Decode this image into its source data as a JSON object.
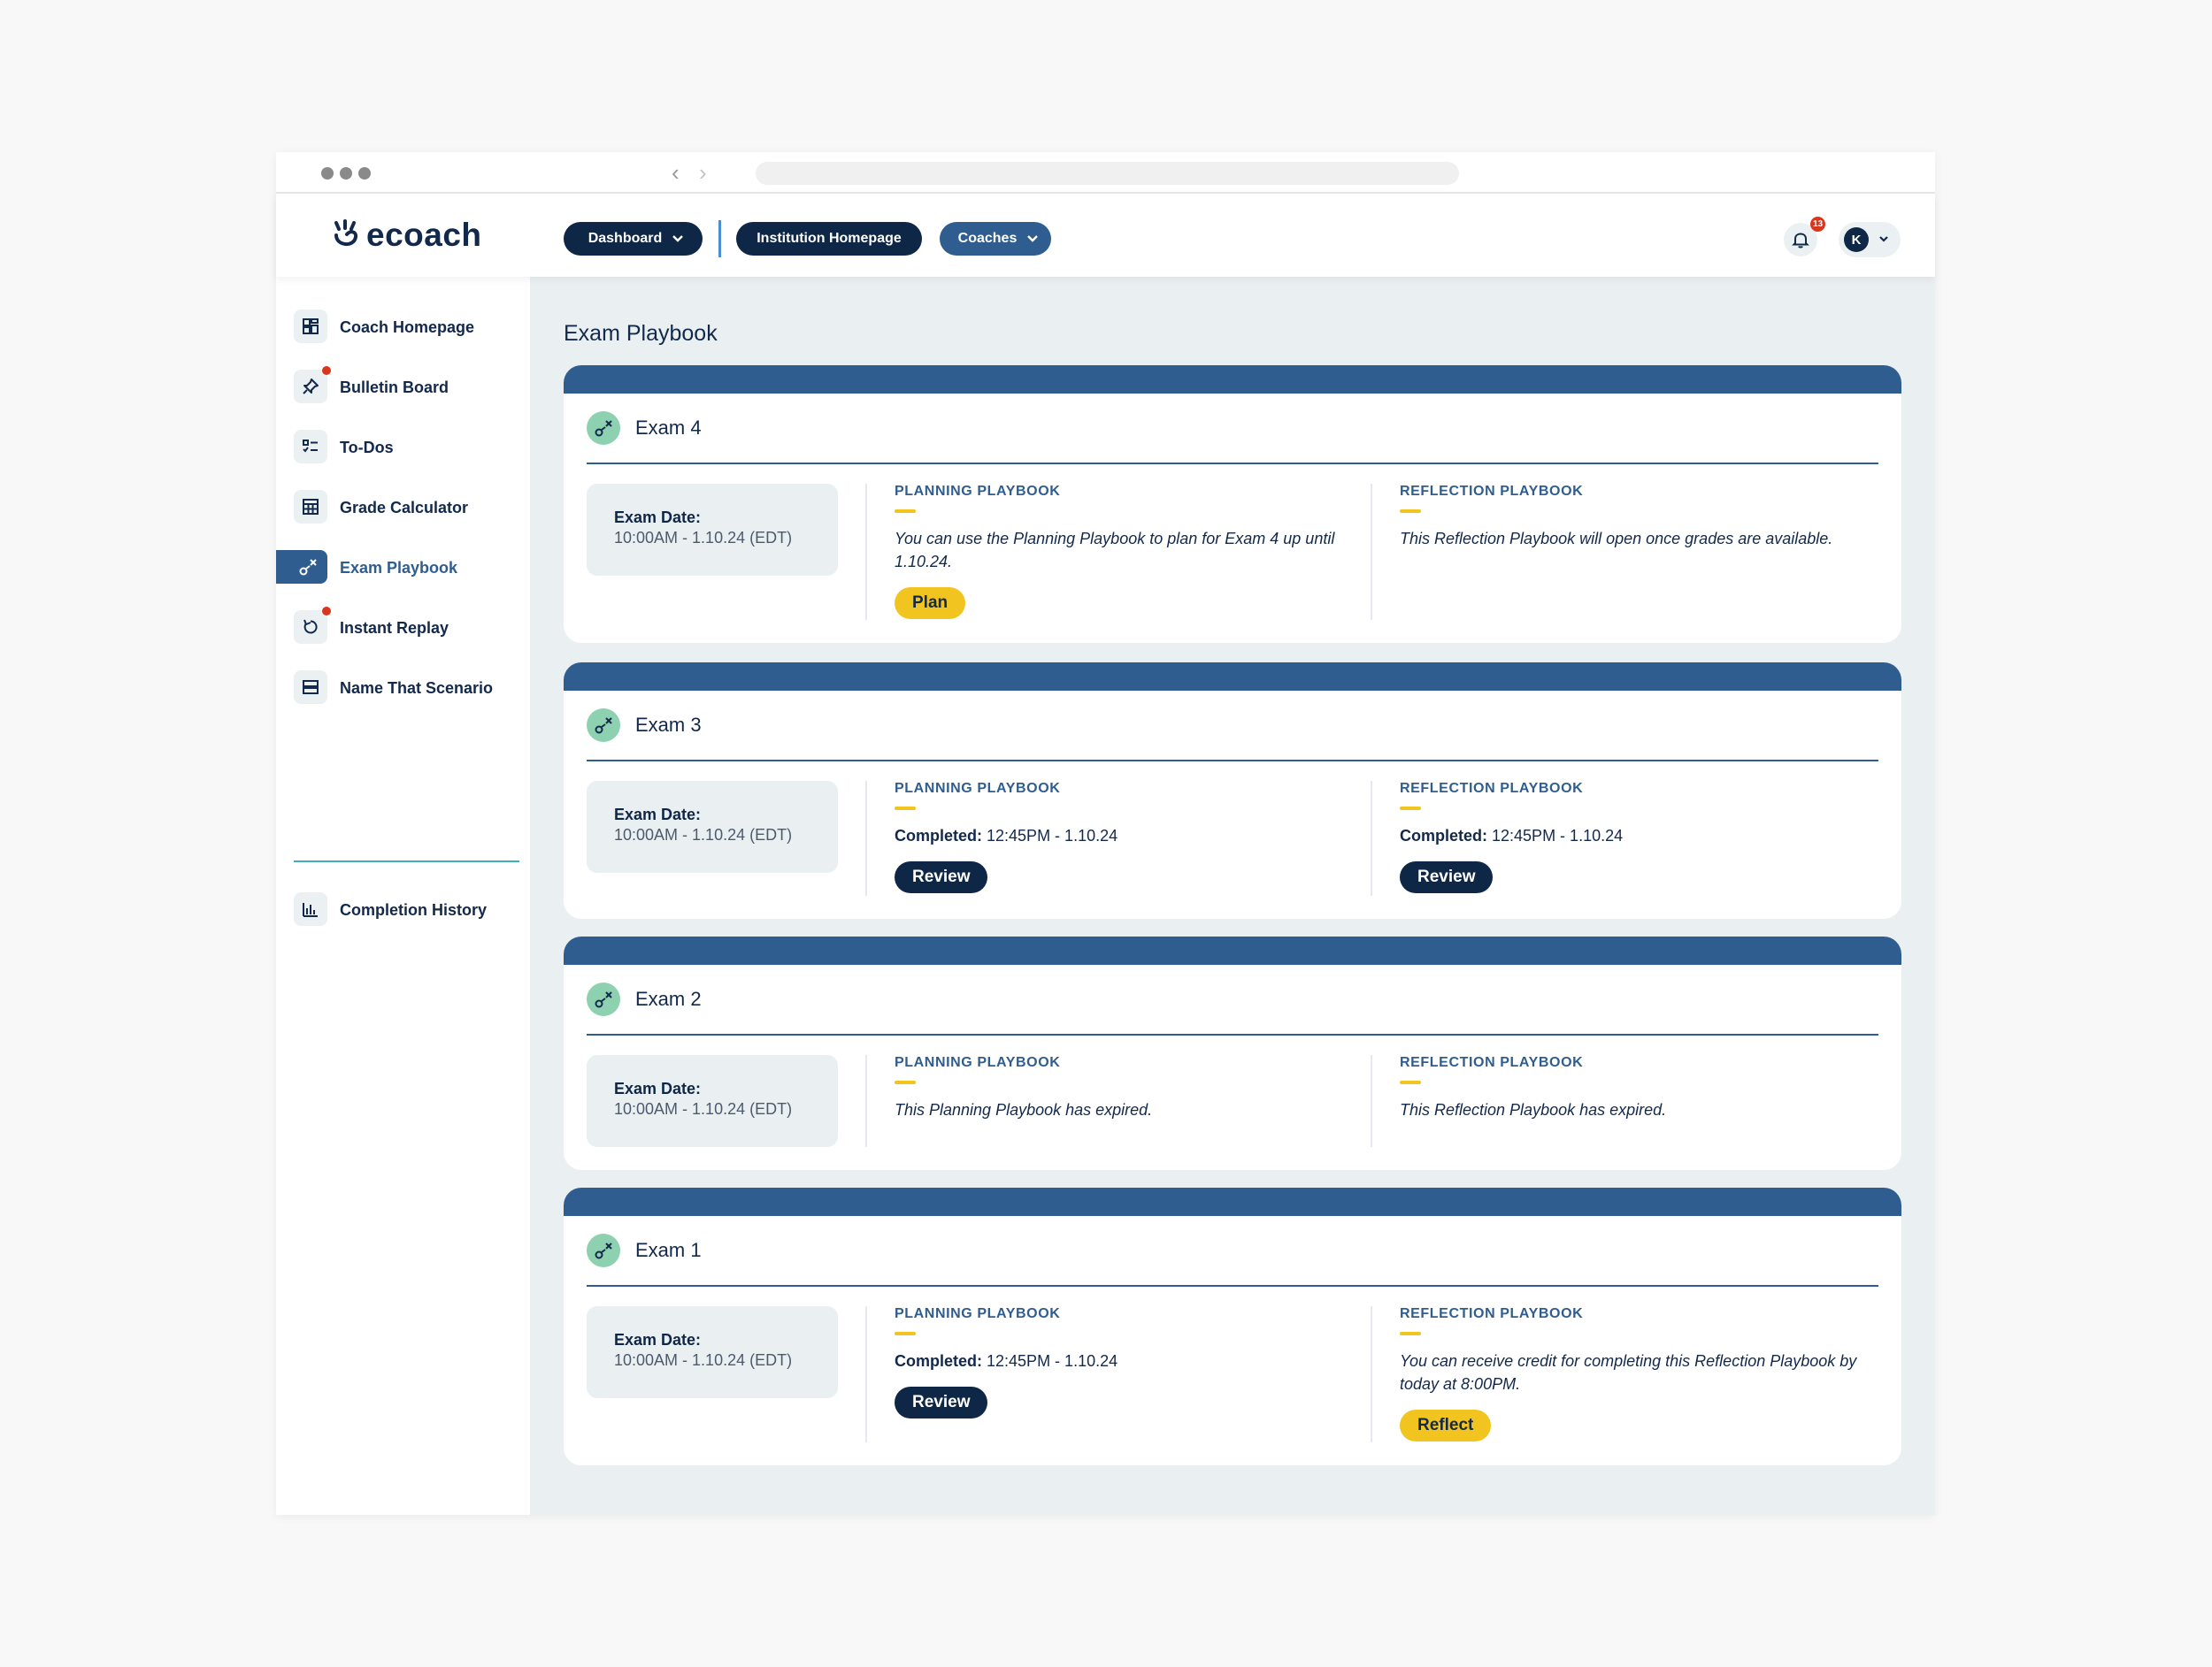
{
  "brand": {
    "name": "ecoach"
  },
  "nav": {
    "dashboard": "Dashboard",
    "institution": "Institution Homepage",
    "coaches": "Coaches",
    "notification_count": "13",
    "user_initial": "K"
  },
  "sidebar": {
    "items": [
      {
        "label": "Coach Homepage",
        "icon": "dashboard-grid-icon",
        "dot": false
      },
      {
        "label": "Bulletin Board",
        "icon": "pushpin-icon",
        "dot": true
      },
      {
        "label": "To-Dos",
        "icon": "checklist-icon",
        "dot": false
      },
      {
        "label": "Grade Calculator",
        "icon": "calculator-icon",
        "dot": false
      },
      {
        "label": "Exam Playbook",
        "icon": "playbook-icon",
        "dot": false,
        "active": true
      },
      {
        "label": "Instant Replay",
        "icon": "replay-icon",
        "dot": true
      },
      {
        "label": "Name That Scenario",
        "icon": "scenario-icon",
        "dot": false
      },
      {
        "label": "Completion History",
        "icon": "bar-chart-icon",
        "dot": false
      }
    ]
  },
  "main": {
    "title": "Exam Playbook",
    "date_label": "Exam Date:",
    "planning_header": "PLANNING PLAYBOOK",
    "reflection_header": "REFLECTION PLAYBOOK",
    "completed_label": "Completed:",
    "exams": [
      {
        "title": "Exam 4",
        "date": "10:00AM - 1.10.24 (EDT)",
        "planning": {
          "message": "You can use the Planning Playbook to plan for Exam 4 up until 1.10.24.",
          "button": "Plan"
        },
        "reflection": {
          "message": "This Reflection Playbook will open once grades are available."
        }
      },
      {
        "title": "Exam 3",
        "date": "10:00AM - 1.10.24 (EDT)",
        "planning": {
          "completed": "12:45PM - 1.10.24",
          "button": "Review"
        },
        "reflection": {
          "completed": "12:45PM - 1.10.24",
          "button": "Review"
        }
      },
      {
        "title": "Exam 2",
        "date": "10:00AM - 1.10.24 (EDT)",
        "planning": {
          "message": "This Planning Playbook has expired."
        },
        "reflection": {
          "message": "This Reflection Playbook has expired."
        }
      },
      {
        "title": "Exam 1",
        "date": "10:00AM - 1.10.24 (EDT)",
        "planning": {
          "completed": "12:45PM - 1.10.24",
          "button": "Review"
        },
        "reflection": {
          "message": "You can receive credit for completing this Reflection Playbook by today at 8:00PM.",
          "button": "Reflect"
        }
      }
    ]
  },
  "colors": {
    "navy": "#0f2747",
    "blue": "#305d8f",
    "yellow": "#f2c41f",
    "mint": "#8ed1b0",
    "teal": "#3fb0ba",
    "alert": "#d9361e",
    "surface": "#eaf0f2"
  }
}
